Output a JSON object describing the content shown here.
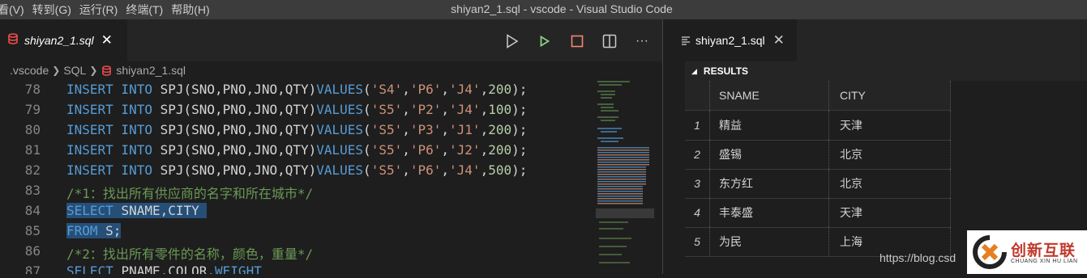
{
  "menu": [
    "看(V)",
    "转到(G)",
    "运行(R)",
    "终端(T)",
    "帮助(H)"
  ],
  "window_title": "shiyan2_1.sql - vscode - Visual Studio Code",
  "editor_tab": {
    "label": "shiyan2_1.sql"
  },
  "breadcrumb": [
    ".vscode",
    "SQL",
    "shiyan2_1.sql"
  ],
  "code_lines": [
    {
      "n": "78",
      "parts": [
        [
          "kw",
          "INSERT INTO "
        ],
        [
          "t",
          "SPJ(SNO,PNO,JNO,QTY)"
        ],
        [
          "kw",
          "VALUES"
        ],
        [
          "t",
          "("
        ],
        [
          "str",
          "'S4'"
        ],
        [
          "t",
          ","
        ],
        [
          "str",
          "'P6'"
        ],
        [
          "t",
          ","
        ],
        [
          "str",
          "'J4'"
        ],
        [
          "t",
          ","
        ],
        [
          "num",
          "200"
        ],
        [
          "t",
          ");"
        ]
      ]
    },
    {
      "n": "79",
      "parts": [
        [
          "kw",
          "INSERT INTO "
        ],
        [
          "t",
          "SPJ(SNO,PNO,JNO,QTY)"
        ],
        [
          "kw",
          "VALUES"
        ],
        [
          "t",
          "("
        ],
        [
          "str",
          "'S5'"
        ],
        [
          "t",
          ","
        ],
        [
          "str",
          "'P2'"
        ],
        [
          "t",
          ","
        ],
        [
          "str",
          "'J4'"
        ],
        [
          "t",
          ","
        ],
        [
          "num",
          "100"
        ],
        [
          "t",
          ");"
        ]
      ]
    },
    {
      "n": "80",
      "parts": [
        [
          "kw",
          "INSERT INTO "
        ],
        [
          "t",
          "SPJ(SNO,PNO,JNO,QTY)"
        ],
        [
          "kw",
          "VALUES"
        ],
        [
          "t",
          "("
        ],
        [
          "str",
          "'S5'"
        ],
        [
          "t",
          ","
        ],
        [
          "str",
          "'P3'"
        ],
        [
          "t",
          ","
        ],
        [
          "str",
          "'J1'"
        ],
        [
          "t",
          ","
        ],
        [
          "num",
          "200"
        ],
        [
          "t",
          ");"
        ]
      ]
    },
    {
      "n": "81",
      "parts": [
        [
          "kw",
          "INSERT INTO "
        ],
        [
          "t",
          "SPJ(SNO,PNO,JNO,QTY)"
        ],
        [
          "kw",
          "VALUES"
        ],
        [
          "t",
          "("
        ],
        [
          "str",
          "'S5'"
        ],
        [
          "t",
          ","
        ],
        [
          "str",
          "'P6'"
        ],
        [
          "t",
          ","
        ],
        [
          "str",
          "'J2'"
        ],
        [
          "t",
          ","
        ],
        [
          "num",
          "200"
        ],
        [
          "t",
          ");"
        ]
      ]
    },
    {
      "n": "82",
      "parts": [
        [
          "kw",
          "INSERT INTO "
        ],
        [
          "t",
          "SPJ(SNO,PNO,JNO,QTY)"
        ],
        [
          "kw",
          "VALUES"
        ],
        [
          "t",
          "("
        ],
        [
          "str",
          "'S5'"
        ],
        [
          "t",
          ","
        ],
        [
          "str",
          "'P6'"
        ],
        [
          "t",
          ","
        ],
        [
          "str",
          "'J4'"
        ],
        [
          "t",
          ","
        ],
        [
          "num",
          "500"
        ],
        [
          "t",
          ");"
        ]
      ]
    },
    {
      "n": "83",
      "parts": [
        [
          "cm",
          "/*1：找出所有供应商的名字和所在城市*/"
        ]
      ]
    },
    {
      "n": "84",
      "sel": true,
      "parts": [
        [
          "kw",
          "SELECT "
        ],
        [
          "t",
          "SNAME,CITY "
        ]
      ]
    },
    {
      "n": "85",
      "sel": true,
      "parts": [
        [
          "kw",
          "FROM "
        ],
        [
          "t",
          "S;"
        ]
      ]
    },
    {
      "n": "86",
      "parts": [
        [
          "cm",
          "/*2：找出所有零件的名称，颜色，重量*/"
        ]
      ]
    },
    {
      "n": "87",
      "parts": [
        [
          "kw",
          "SELECT "
        ],
        [
          "t",
          "PNAME,COLOR,"
        ],
        [
          "kw",
          "WEIGHT"
        ]
      ]
    }
  ],
  "results_tab": {
    "label": "shiyan2_1.sql"
  },
  "results": {
    "header": "RESULTS",
    "columns": [
      "SNAME",
      "CITY"
    ],
    "rows": [
      {
        "n": "1",
        "sname": "精益",
        "city": "天津"
      },
      {
        "n": "2",
        "sname": "盛锡",
        "city": "北京"
      },
      {
        "n": "3",
        "sname": "东方红",
        "city": "北京"
      },
      {
        "n": "4",
        "sname": "丰泰盛",
        "city": "天津"
      },
      {
        "n": "5",
        "sname": "为民",
        "city": "上海"
      }
    ]
  },
  "watermark": {
    "url": "https://blog.csd",
    "brand": "创新互联",
    "brand_sub": "CHUANG XIN HU LIAN"
  },
  "colors": {
    "keyword": "#569cd6",
    "string": "#ce9178",
    "number": "#b5cea8",
    "comment": "#6a9955",
    "run": "#89d185",
    "stop": "#f48771",
    "selection": "#264f78",
    "db_icon": "#f14c4c"
  }
}
